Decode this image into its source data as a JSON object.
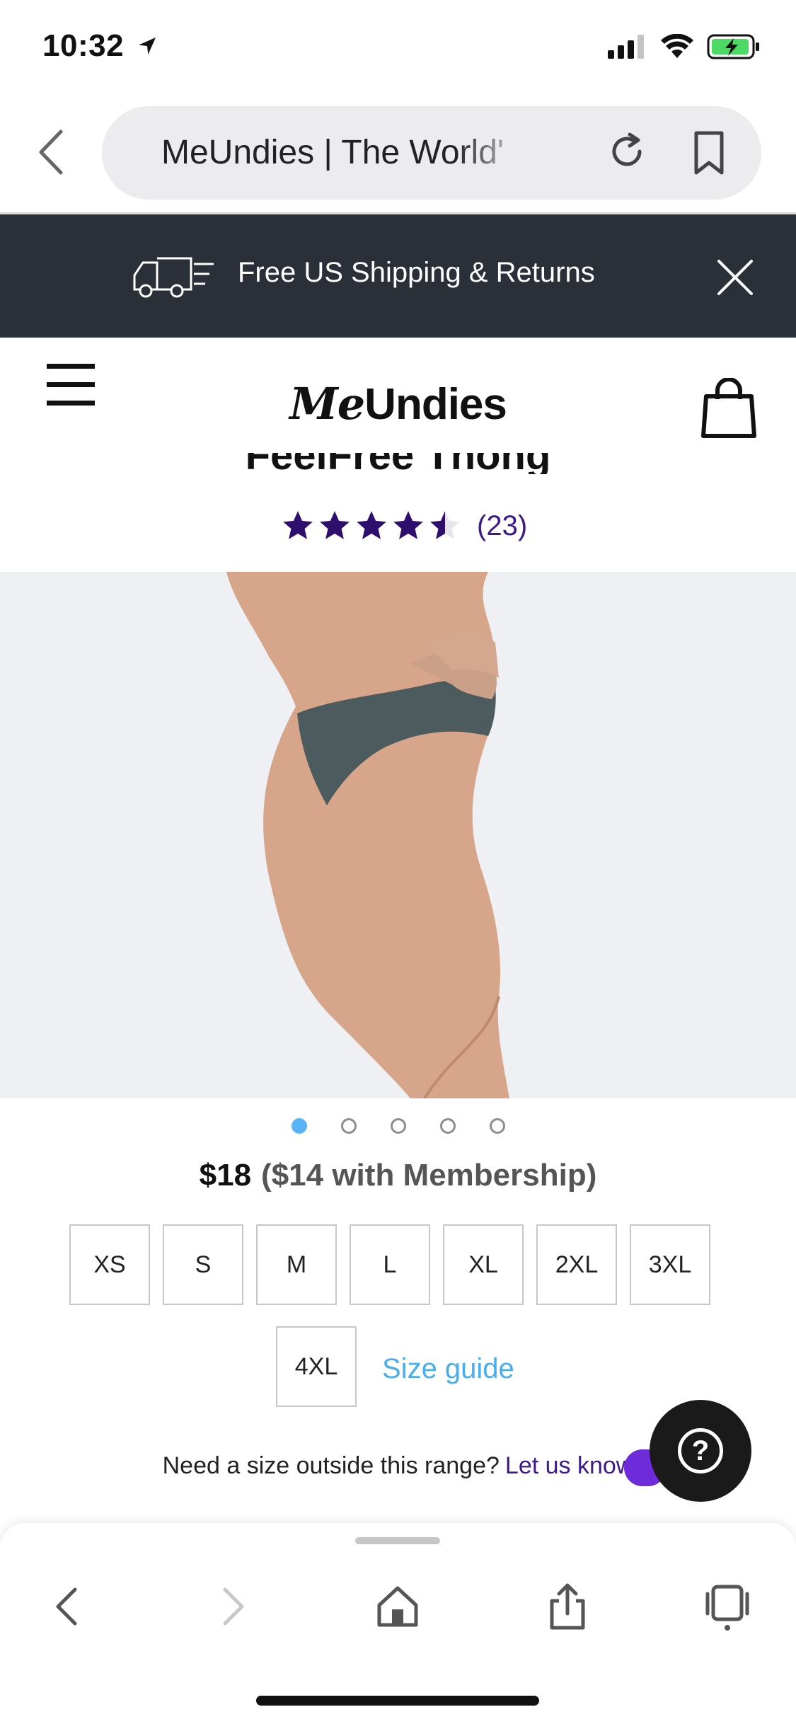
{
  "status_bar": {
    "time": "10:32"
  },
  "browser": {
    "url_text": "MeUndies | The World'",
    "back_icon": "chevron-left-icon",
    "reload_icon": "reload-icon",
    "bookmark_icon": "bookmark-icon"
  },
  "promo": {
    "text": "Free US Shipping & Returns",
    "icon": "truck-icon"
  },
  "header": {
    "logo_me": "Me",
    "logo_undies": "Undies",
    "menu_icon": "hamburger-icon",
    "cart_icon": "shopping-bag-icon"
  },
  "product": {
    "title": "FeelFree Thong",
    "rating_value": 4.5,
    "review_count": "(23)",
    "price": "$18",
    "member_price": "($14 with Membership)",
    "image_count": 5,
    "active_image": 1
  },
  "sizes": [
    "XS",
    "S",
    "M",
    "L",
    "XL",
    "2XL",
    "3XL",
    "4XL"
  ],
  "size_guide": "Size guide",
  "outside_range": {
    "text": "Need a size outside this range?",
    "link": "Let us know"
  },
  "colors": {
    "promo_bg": "#2b2f38",
    "accent_purple": "#3d1a8a",
    "link_blue": "#48aef0",
    "dot_active": "#59b4f5"
  }
}
